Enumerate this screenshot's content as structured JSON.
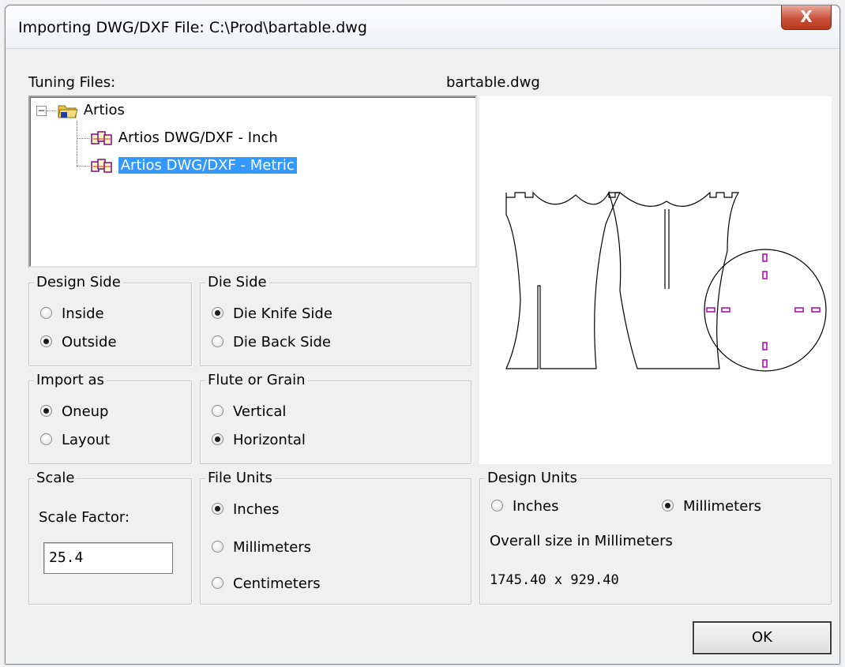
{
  "window": {
    "title": "Importing DWG/DXF File: C:\\Prod\\bartable.dwg",
    "close_glyph": "X"
  },
  "tuning": {
    "label": "Tuning Files:",
    "tree": {
      "root_label": "Artios",
      "root_expander": "−",
      "items": [
        {
          "label": "Artios DWG/DXF - Inch",
          "selected": false
        },
        {
          "label": "Artios DWG/DXF - Metric",
          "selected": true
        }
      ]
    }
  },
  "preview": {
    "filename": "bartable.dwg"
  },
  "design_side": {
    "title": "Design Side",
    "options": [
      "Inside",
      "Outside"
    ],
    "selected": "Outside"
  },
  "die_side": {
    "title": "Die Side",
    "options": [
      "Die Knife Side",
      "Die Back Side"
    ],
    "selected": "Die Knife Side"
  },
  "import_as": {
    "title": "Import as",
    "options": [
      "Oneup",
      "Layout"
    ],
    "selected": "Oneup"
  },
  "flute": {
    "title": "Flute or Grain",
    "options": [
      "Vertical",
      "Horizontal"
    ],
    "selected": "Horizontal"
  },
  "scale": {
    "title": "Scale",
    "factor_label": "Scale Factor:",
    "factor_value": "25.4"
  },
  "file_units": {
    "title": "File Units",
    "options": [
      "Inches",
      "Millimeters",
      "Centimeters"
    ],
    "selected": "Inches"
  },
  "design_units": {
    "title": "Design Units",
    "options": [
      "Inches",
      "Millimeters"
    ],
    "selected": "Millimeters",
    "size_label": "Overall size in Millimeters",
    "size_value": "1745.40 x 929.40"
  },
  "ok_label": "OK",
  "colors": {
    "selection": "#3399ff",
    "close": "#c9503a",
    "marker": "#b000b0",
    "folder": "#e8c44a"
  },
  "icons": [
    "folder-icon",
    "tuning-file-icon",
    "close-icon"
  ]
}
